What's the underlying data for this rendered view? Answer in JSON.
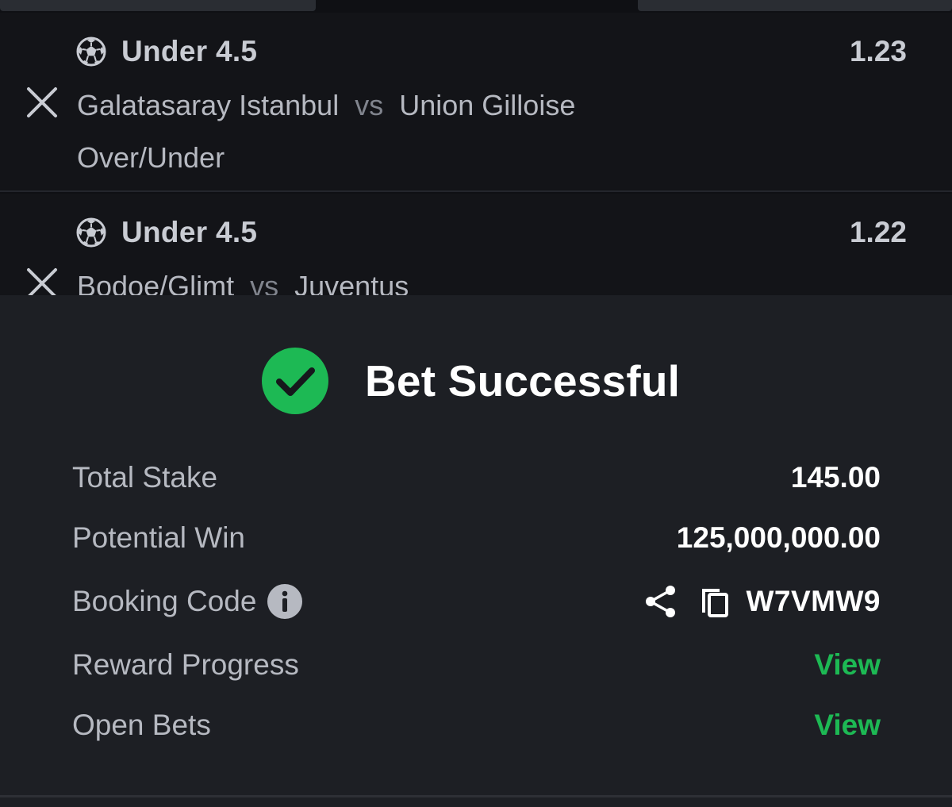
{
  "selections": [
    {
      "market": "Under 4.5",
      "odds": "1.23",
      "home": "Galatasaray Istanbul",
      "vs": "vs",
      "away": "Union Gilloise",
      "bet_type": "Over/Under",
      "icon": "soccer-ball-icon"
    },
    {
      "market": "Under 4.5",
      "odds": "1.22",
      "home": "Bodoe/Glimt",
      "vs": "vs",
      "away": "Juventus",
      "icon": "soccer-ball-icon"
    }
  ],
  "success": {
    "title": "Bet Successful",
    "icon": "check-circle-icon",
    "accent_color": "#1db954"
  },
  "summary": {
    "total_stake_label": "Total Stake",
    "total_stake_value": "145.00",
    "potential_win_label": "Potential Win",
    "potential_win_value": "125,000,000.00",
    "booking_code_label": "Booking Code",
    "booking_code_value": "W7VMW9",
    "reward_progress_label": "Reward Progress",
    "reward_progress_link": "View",
    "open_bets_label": "Open Bets",
    "open_bets_link": "View"
  }
}
